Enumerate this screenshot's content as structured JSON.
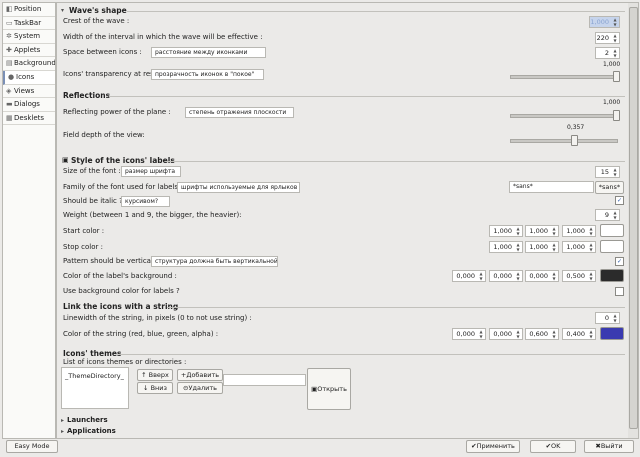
{
  "sidebar": {
    "items": [
      {
        "label": "Position",
        "icon": "position-icon"
      },
      {
        "label": "TaskBar",
        "icon": "taskbar-icon"
      },
      {
        "label": "System",
        "icon": "system-icon"
      },
      {
        "label": "Applets",
        "icon": "applets-icon"
      },
      {
        "label": "Background",
        "icon": "background-icon"
      },
      {
        "label": "Icons",
        "icon": "icons-icon"
      },
      {
        "label": "Views",
        "icon": "views-icon"
      },
      {
        "label": "Dialogs",
        "icon": "dialogs-icon"
      },
      {
        "label": "Desklets",
        "icon": "desklets-icon"
      }
    ],
    "active": "Icons"
  },
  "waves": {
    "title": "Wave's shape",
    "crest_label": "Crest of the wave :",
    "crest_value": "1,000",
    "width_label": "Width of the interval in which the wave will be effective :",
    "width_value": "220",
    "space_label": "Space between icons :",
    "space_hint": "расстояние между иконками",
    "space_value": "2",
    "transp_label": "Icons' transparency at rest :",
    "transp_hint": "прозрачность иконок в \"покое\"",
    "transp_value": "1,000",
    "transp_level": 1.0
  },
  "reflections": {
    "title": "Reflections",
    "power_label": "Reflecting power of the plane :",
    "power_hint": "степень отражения плоскости",
    "power_value": "1,000",
    "power_level": 1.0,
    "depth_label": "Field depth of the view:",
    "depth_value": "0,357",
    "depth_level": 0.357
  },
  "labels": {
    "title": "Style of the icons' labels",
    "size_label": "Size of the font :",
    "size_hint": "размер шрифта",
    "size_value": "15",
    "family_label": "Family of the font used for labels :",
    "family_hint": "шрифты используемые для ярлыков",
    "family_value": "*sans*",
    "family_button": "*sans*",
    "italic_label": "Should be italic ?",
    "italic_hint": "курсивом?",
    "italic_checked": true,
    "weight_label": "Weight (between 1 and 9, the bigger, the heavier):",
    "weight_value": "9",
    "start_label": "Start color :",
    "start_values": [
      "1,000",
      "1,000",
      "1,000"
    ],
    "stop_label": "Stop color :",
    "stop_values": [
      "1,000",
      "1,000",
      "1,000"
    ],
    "vertical_label": "Pattern should be vertical ?",
    "vertical_hint": "структура должна быть вертикальной?",
    "vertical_checked": true,
    "bg_label": "Color of the label's background :",
    "bg_values": [
      "0,000",
      "0,000",
      "0,000",
      "0,500"
    ],
    "usebg_label": "Use background color for labels ?",
    "usebg_checked": false
  },
  "string": {
    "title": "Link the icons with a string",
    "linewidth_label": "Linewidth of the string, in pixels (0 to not use string) :",
    "linewidth_value": "0",
    "color_label": "Color of the string (red, blue, green, alpha) :",
    "color_values": [
      "0,000",
      "0,000",
      "0,600",
      "0,400"
    ]
  },
  "themes": {
    "title": "Icons' themes",
    "list_label": "List of icons themes or directories :",
    "list_items": [
      "_ThemeDirectory_"
    ],
    "up": "Вверх",
    "add": "Добавить",
    "down": "Вниз",
    "remove": "Удалить",
    "open": "Открыть"
  },
  "collapsed": {
    "launchers": "Launchers",
    "applications": "Applications"
  },
  "bottom": {
    "easy_mode": "Easy Mode",
    "apply": "Применить",
    "ok": "OK",
    "quit": "Выйти"
  },
  "colors": {
    "start_swatch": "#ffffff",
    "stop_swatch": "#ffffff",
    "bg_swatch": "#2b2b2b",
    "string_swatch": "#3a3ab0"
  }
}
